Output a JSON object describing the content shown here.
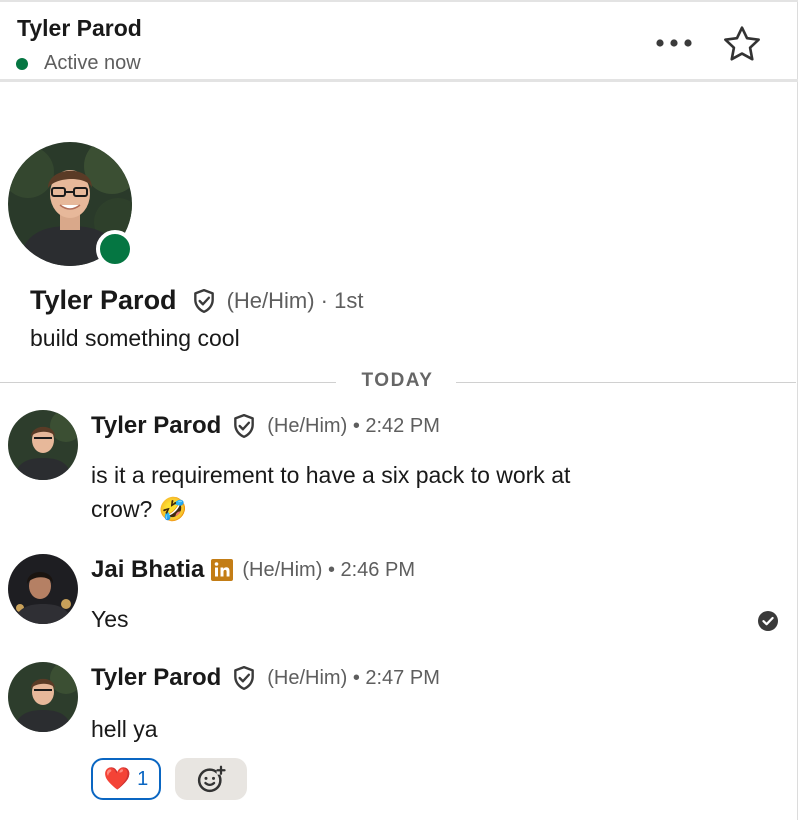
{
  "header": {
    "name": "Tyler Parod",
    "status": "Active now",
    "status_color": "#057642",
    "more_icon": "more-horizontal-icon",
    "star_icon": "star-outline-icon"
  },
  "profile": {
    "name": "Tyler Parod",
    "pronouns_connection": "(He/Him) · 1st",
    "headline": "build something cool",
    "verified_icon": "verified-shield-icon"
  },
  "divider": {
    "label": "TODAY"
  },
  "messages": [
    {
      "sender": "Tyler Parod",
      "badge": "verified-shield-icon",
      "meta": "(He/Him) • 2:42 PM",
      "lines": [
        "is it a requirement to have a six pack to work at",
        "crow? 🤣"
      ]
    },
    {
      "sender": "Jai Bhatia",
      "badge": "linkedin-premium-icon",
      "meta": "(He/Him) • 2:46 PM",
      "lines": [
        "Yes"
      ],
      "read_icon": "read-receipt-check-icon"
    },
    {
      "sender": "Tyler Parod",
      "badge": "verified-shield-icon",
      "meta": "(He/Him) • 2:47 PM",
      "lines": [
        "hell ya"
      ]
    }
  ],
  "reactions": {
    "heart_emoji": "❤️",
    "heart_count": "1",
    "add_reaction_icon": "add-emoji-reaction-icon",
    "accent_color": "#0a66c2"
  }
}
